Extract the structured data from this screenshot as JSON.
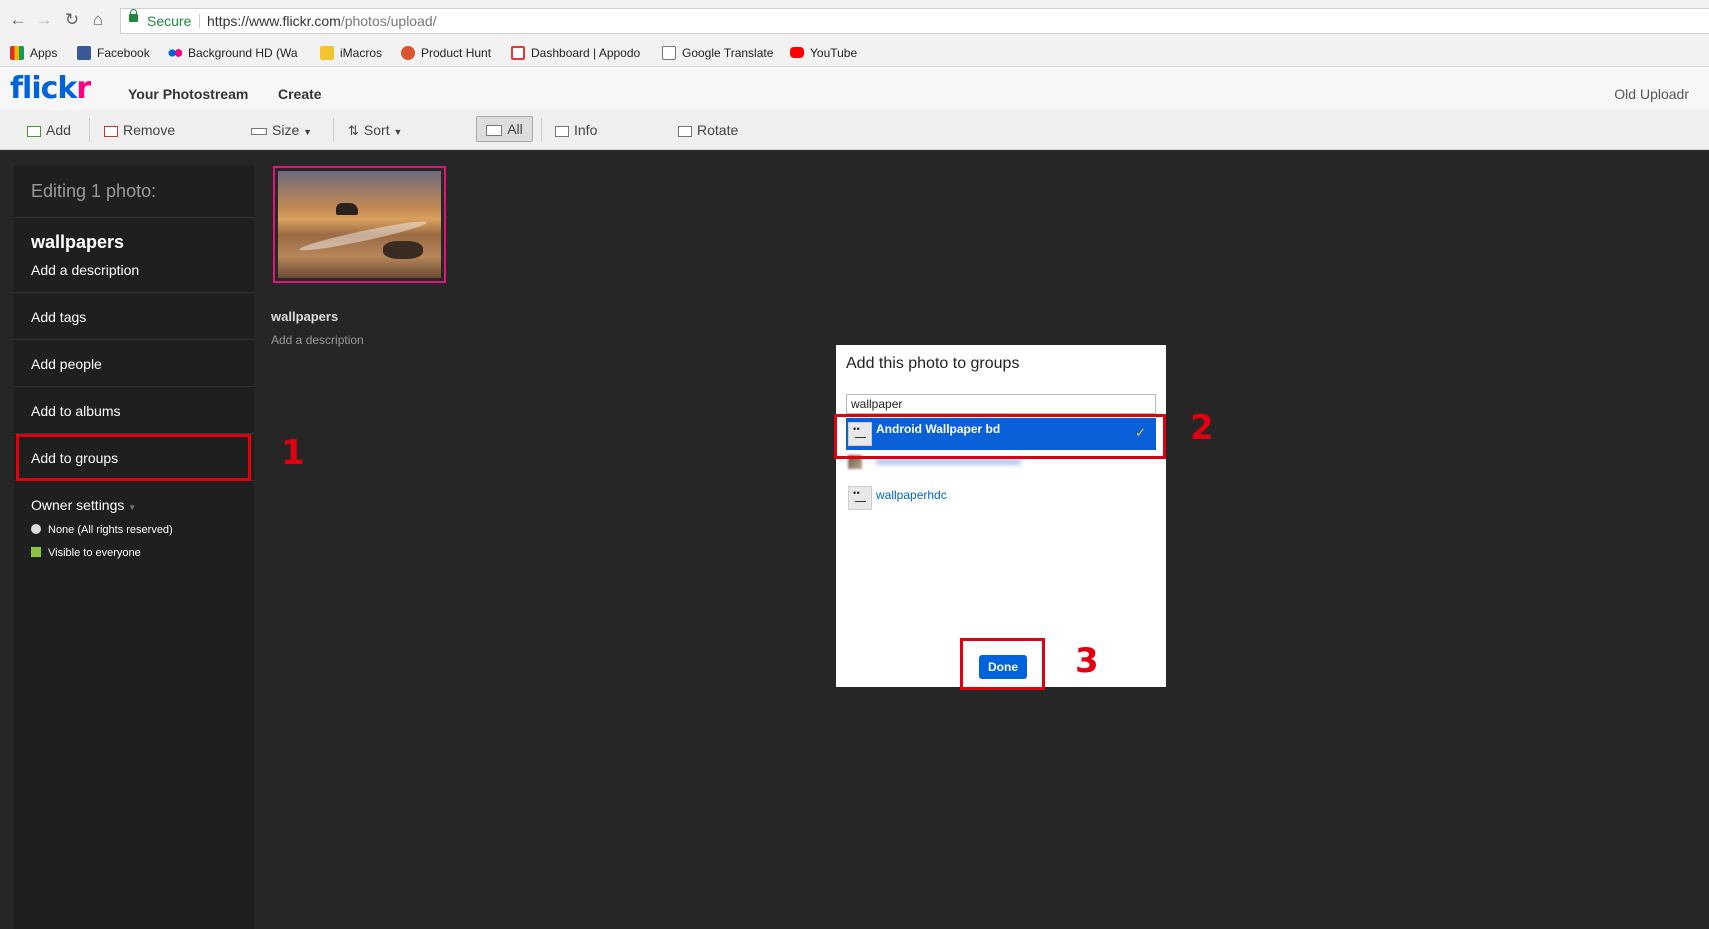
{
  "browser": {
    "secure_label": "Secure",
    "url_host": "https://www.flickr.com",
    "url_path": "/photos/upload/"
  },
  "bookmarks": [
    {
      "label": "Apps",
      "icon": "apps-grid-icon",
      "color": "#d93025"
    },
    {
      "label": "Facebook",
      "icon": "facebook-icon",
      "color": "#3b5998"
    },
    {
      "label": "Background HD (Wa",
      "icon": "flickr-dots-icon",
      "color": "#0063dc"
    },
    {
      "label": "iMacros",
      "icon": "folder-icon",
      "color": "#f4c430"
    },
    {
      "label": "Product Hunt",
      "icon": "product-hunt-icon",
      "color": "#da552f"
    },
    {
      "label": "Dashboard | Appodo",
      "icon": "appodeal-icon",
      "color": "#e53935"
    },
    {
      "label": "Google Translate",
      "icon": "page-icon",
      "color": "#ffffff"
    },
    {
      "label": "YouTube",
      "icon": "youtube-icon",
      "color": "#ff0000"
    }
  ],
  "header": {
    "logo_main": "flick",
    "logo_accent": "r",
    "nav": [
      "Your Photostream",
      "Create"
    ],
    "old_uploadr": "Old Uploadr"
  },
  "toolbar": {
    "add": "Add",
    "remove": "Remove",
    "size": "Size",
    "sort": "Sort",
    "all": "All",
    "info": "Info",
    "rotate": "Rotate"
  },
  "sidebar": {
    "editing_title": "Editing 1 photo:",
    "photo_title": "wallpapers",
    "add_description": "Add a description",
    "add_tags": "Add tags",
    "add_people": "Add people",
    "add_albums": "Add to albums",
    "add_groups": "Add to groups",
    "owner_settings": "Owner settings",
    "license": "None (All rights reserved)",
    "visibility": "Visible to everyone"
  },
  "photo": {
    "title": "wallpapers",
    "description": "Add a description"
  },
  "groups_dialog": {
    "title": "Add this photo to groups",
    "search_value": "wallpaper",
    "groups": [
      {
        "name": "Android Wallpaper bd",
        "selected": true
      },
      {
        "name": "wallpaperhdc",
        "selected": false
      }
    ],
    "done": "Done"
  },
  "annotations": [
    "1",
    "2",
    "3"
  ],
  "colors": {
    "accent": "#0063dc",
    "flickr_pink": "#ff0084",
    "highlight": "#e00010",
    "selected_row": "#0a60d8"
  }
}
